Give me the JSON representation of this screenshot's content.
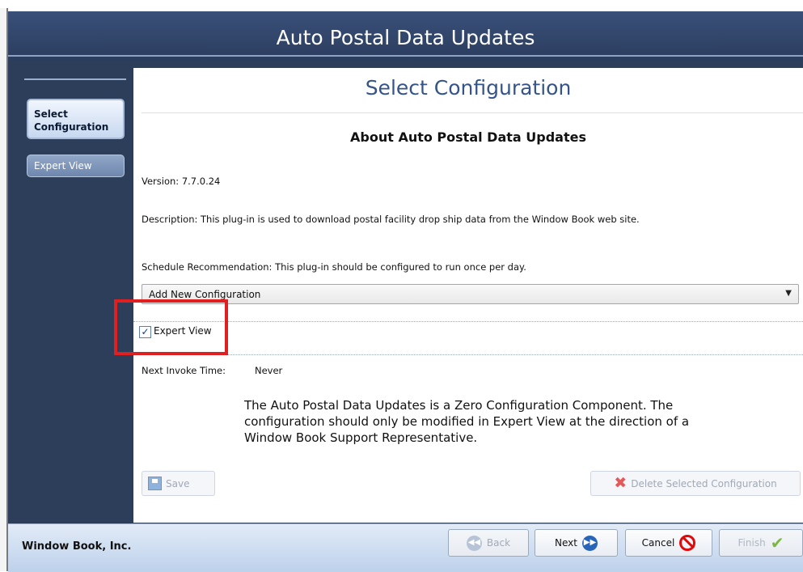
{
  "window": {
    "title": "Auto Postal Data Updates"
  },
  "sidebar": {
    "items": [
      {
        "label": "Select\nConfiguration"
      },
      {
        "label": "Expert View"
      }
    ]
  },
  "main": {
    "heading": "Select Configuration",
    "subheading": "About Auto Postal Data Updates",
    "version": "Version: 7.7.0.24",
    "description": "Description: This plug-in is used to download postal facility drop ship data from the Window Book web site.",
    "schedule": "Schedule Recommendation: This plug-in should be configured to run once per day.",
    "configuration_select": {
      "value": "Add New Configuration"
    },
    "expert_view": {
      "label": "Expert View",
      "checked": true
    },
    "next_invoke": {
      "label": "Next Invoke Time:",
      "value": "Never"
    },
    "message": "The Auto Postal Data Updates is a Zero Configuration Component. The configuration should only be modified in Expert View at the direction of a Window Book Support Representative.",
    "buttons": {
      "save": "Save",
      "delete": "Delete Selected Configuration"
    }
  },
  "footer": {
    "company": "Window Book, Inc.",
    "buttons": {
      "back": "Back",
      "next": "Next",
      "cancel": "Cancel",
      "finish": "Finish"
    }
  },
  "icons": {
    "save": "save-icon",
    "delete": "delete-icon",
    "back": "back-arrow-icon",
    "next": "next-arrow-icon",
    "cancel": "cancel-icon",
    "finish": "checkmark-icon"
  },
  "colors": {
    "title_bar": "#2d3e5b",
    "heading_blue": "#34548a",
    "highlight_box": "#e02020"
  }
}
